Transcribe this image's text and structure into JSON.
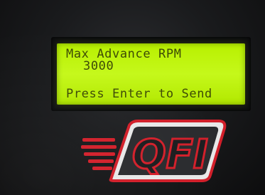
{
  "display": {
    "line1": "Max Advance RPM",
    "line2": "3000",
    "line3": "Press Enter to Send"
  },
  "brand": {
    "logo_text": "QFI",
    "logo_colors": {
      "outline": "#d21f2a",
      "fill": "#2a2b2e",
      "highlight": "#f2f2f2"
    }
  },
  "colors": {
    "lcd_background": "#c0f510",
    "lcd_text": "#3d4a06",
    "device_body": "#1a1b1d"
  }
}
